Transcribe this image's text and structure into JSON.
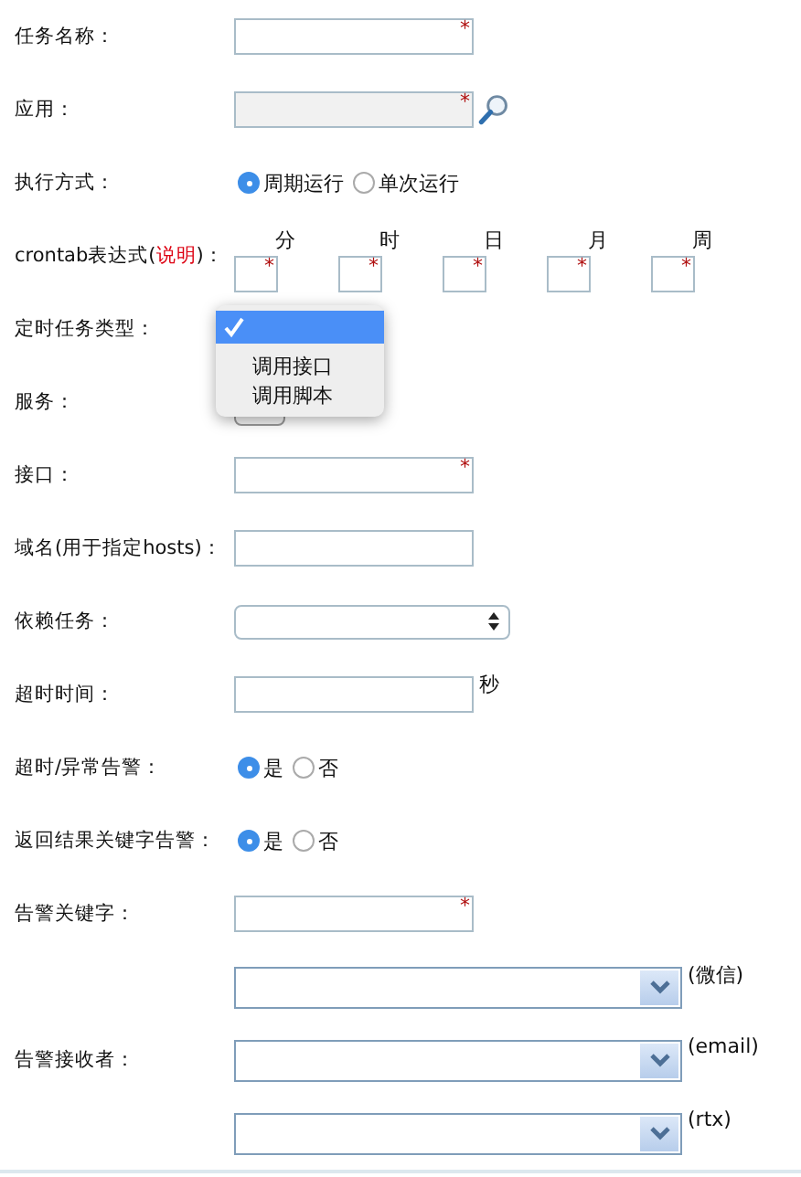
{
  "rows": [
    {
      "kind": "text",
      "label": "任务名称：",
      "mark": "*"
    },
    {
      "kind": "lookup",
      "label": "应用：",
      "mark": "*"
    },
    {
      "kind": "radio",
      "label": "执行方式：",
      "options": [
        {
          "label": "周期运行",
          "selected": true
        },
        {
          "label": "单次运行",
          "selected": false
        }
      ]
    },
    {
      "kind": "crontab",
      "label": "crontab表达式(",
      "link": "说明",
      "label_end": ")：",
      "cells": [
        {
          "heading": "分",
          "mark": "*"
        },
        {
          "heading": "时",
          "mark": "*"
        },
        {
          "heading": "日",
          "mark": "*"
        },
        {
          "heading": "月",
          "mark": "*"
        },
        {
          "heading": "周",
          "mark": "*"
        }
      ]
    },
    {
      "kind": "dropdown",
      "label": "定时任务类型：",
      "open": true,
      "options": [
        {
          "selected": true
        },
        {
          "label": "调用接口",
          "selected": false
        },
        {
          "label": "调用脚本",
          "selected": false
        }
      ]
    },
    {
      "kind": "hidden-select",
      "label": "服务："
    },
    {
      "kind": "text",
      "label": "接口：",
      "mark": "*"
    },
    {
      "kind": "text",
      "label": "域名(用于指定hosts)："
    },
    {
      "kind": "select",
      "label": "依赖任务："
    },
    {
      "kind": "text",
      "label": "超时时间：",
      "suffix": "秒"
    },
    {
      "kind": "radio",
      "label": "超时/异常告警：",
      "options": [
        {
          "label": "是",
          "selected": true
        },
        {
          "label": "否",
          "selected": false
        }
      ]
    },
    {
      "kind": "radio",
      "label": "返回结果关键字告警：",
      "options": [
        {
          "label": "是",
          "selected": true
        },
        {
          "label": "否",
          "selected": false
        }
      ]
    },
    {
      "kind": "text",
      "label": "告警关键字：",
      "mark": "*"
    },
    {
      "kind": "combo",
      "suffix": "(微信)"
    },
    {
      "kind": "combo",
      "label": "告警接收者：",
      "suffix": "(email)"
    },
    {
      "kind": "combo",
      "suffix": "(rtx)"
    }
  ]
}
